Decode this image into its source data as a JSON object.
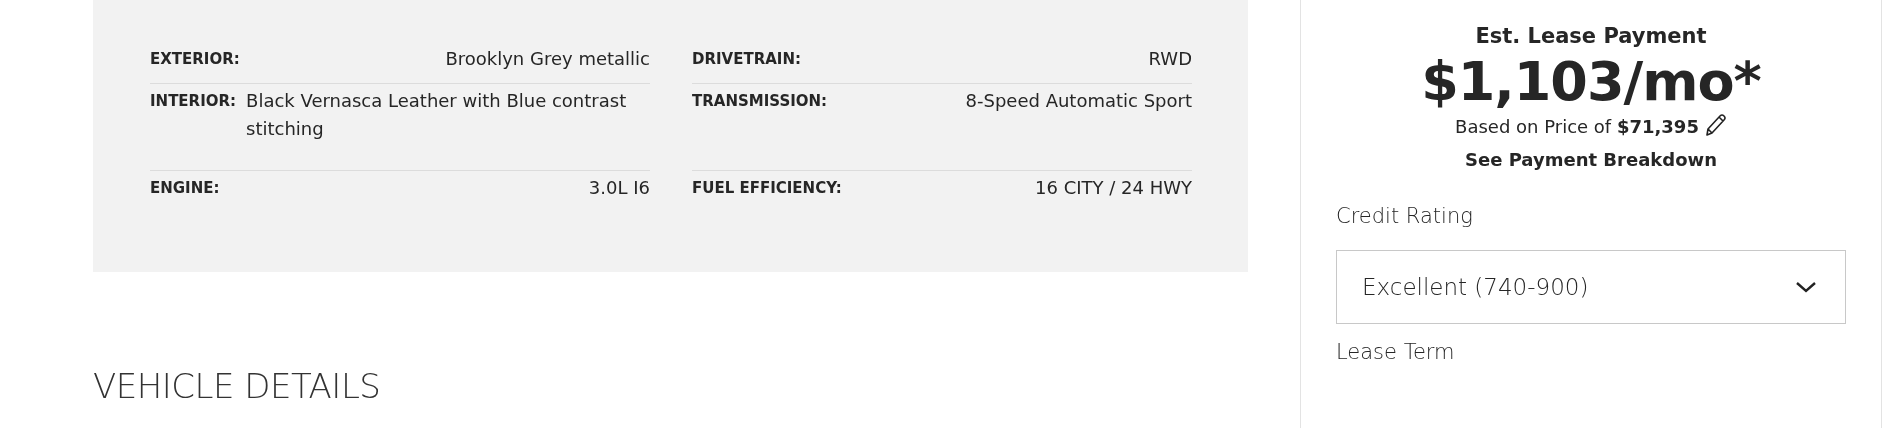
{
  "specs": {
    "columns": [
      [
        {
          "label": "EXTERIOR:",
          "value": "Brooklyn Grey metallic"
        },
        {
          "label": "INTERIOR:",
          "value": "Black Vernasca Leather with Blue contrast stitching"
        },
        {
          "label": "ENGINE:",
          "value": "3.0L I6"
        }
      ],
      [
        {
          "label": "DRIVETRAIN:",
          "value": "RWD"
        },
        {
          "label": "TRANSMISSION:",
          "value": "8-Speed Automatic Sport"
        },
        {
          "label": "FUEL EFFICIENCY:",
          "value": "16 CITY / 24 HWY"
        }
      ]
    ]
  },
  "section_heading": "VEHICLE DETAILS",
  "lease": {
    "title": "Est. Lease Payment",
    "payment": "$1,103/mo*",
    "based_on": "Based on Price of **$71,395**",
    "breakdown_link": "See Payment Breakdown",
    "credit_label": "Credit Rating",
    "credit_value": "Excellent (740-900)",
    "term_label": "Lease Term"
  }
}
